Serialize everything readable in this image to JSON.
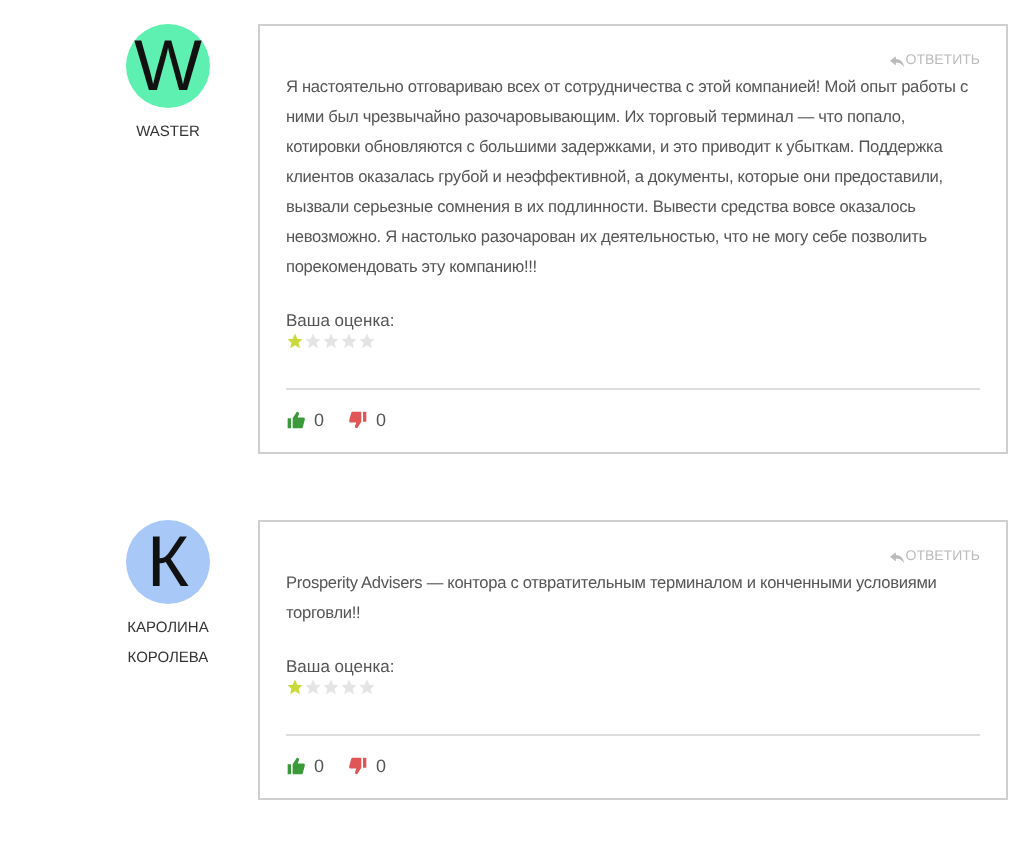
{
  "comments": [
    {
      "avatar": {
        "letter": "W",
        "color": "#5ef0b0"
      },
      "author": "WASTER",
      "reply": "ОТВЕТИТЬ",
      "text": "Я настоятельно отговариваю всех от сотрудничества с этой компанией! Мой опыт работы с ними был чрезвычайно разочаровывающим. Их торговый терминал — что попало, котировки обновляются с большими задержками, и это приводит к убыткам. Поддержка клиентов оказалась грубой и неэффективной, а документы, которые они предоставили, вызвали серьезные сомнения в их подлинности. Вывести средства вовсе оказалось невозможно. Я настолько разочарован их деятельностью, что не могу себе позволить порекомендовать эту компанию!!!",
      "rating_label": "Ваша оценка:",
      "stars": 1,
      "likes": "0",
      "dislikes": "0"
    },
    {
      "avatar": {
        "letter": "К",
        "color": "#a8c8f8"
      },
      "author": "КАРОЛИНА КОРОЛЕВА",
      "reply": "ОТВЕТИТЬ",
      "text": "Prosperity Advisers — контора с отвратительным терминалом и конченными условиями торговли!!",
      "rating_label": "Ваша оценка:",
      "stars": 1,
      "likes": "0",
      "dislikes": "0"
    }
  ]
}
